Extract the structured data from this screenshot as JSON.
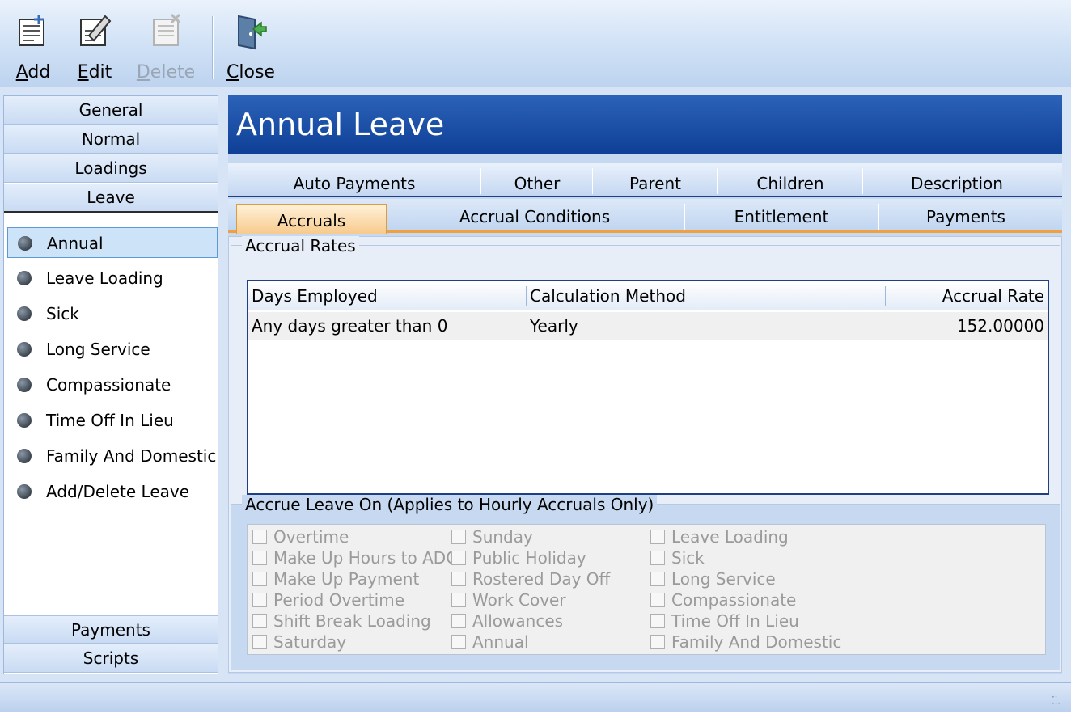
{
  "toolbar": {
    "add": {
      "key": "A",
      "rest": "dd",
      "icon": "document-add-icon"
    },
    "edit": {
      "key": "E",
      "rest": "dit",
      "icon": "document-edit-icon"
    },
    "delete": {
      "key": "D",
      "rest": "elete",
      "icon": "document-delete-icon",
      "disabled": true
    },
    "close": {
      "key": "C",
      "rest": "lose",
      "icon": "exit-door-icon"
    }
  },
  "nav": {
    "top_sections": [
      "General",
      "Normal",
      "Loadings",
      "Leave"
    ],
    "active_section": "Leave",
    "items": [
      "Annual",
      "Leave Loading",
      "Sick",
      "Long Service",
      "Compassionate",
      "Time Off In Lieu",
      "Family And Domestic",
      "Add/Delete Leave"
    ],
    "selected_item": "Annual",
    "bottom_sections": [
      "Payments",
      "Scripts"
    ]
  },
  "main": {
    "title": "Annual Leave",
    "tabs_row1": [
      "Auto Payments",
      "Other",
      "Parent",
      "Children",
      "Description"
    ],
    "tabs_row2": [
      "Accruals",
      "Accrual Conditions",
      "Entitlement",
      "Payments"
    ],
    "active_tab": "Accruals",
    "accrual_rates": {
      "group_title": "Accrual Rates",
      "columns": [
        "Days Employed",
        "Calculation Method",
        "Accrual Rate"
      ],
      "rows": [
        {
          "days_employed": "Any days greater than 0",
          "calculation_method": "Yearly",
          "accrual_rate": "152.00000"
        }
      ]
    },
    "accrue_on": {
      "group_title": "Accrue Leave On (Applies to Hourly Accruals Only)",
      "col1": [
        "Overtime",
        "Make Up Hours to ADO",
        "Make Up Payment",
        "Period Overtime",
        "Shift Break Loading",
        "Saturday"
      ],
      "col2": [
        "Sunday",
        "Public Holiday",
        "Rostered Day Off",
        "Work Cover",
        "Allowances",
        "Annual"
      ],
      "col3": [
        "Leave Loading",
        "Sick",
        "Long Service",
        "Compassionate",
        "Time Off In Lieu",
        "Family And Domestic"
      ]
    }
  }
}
